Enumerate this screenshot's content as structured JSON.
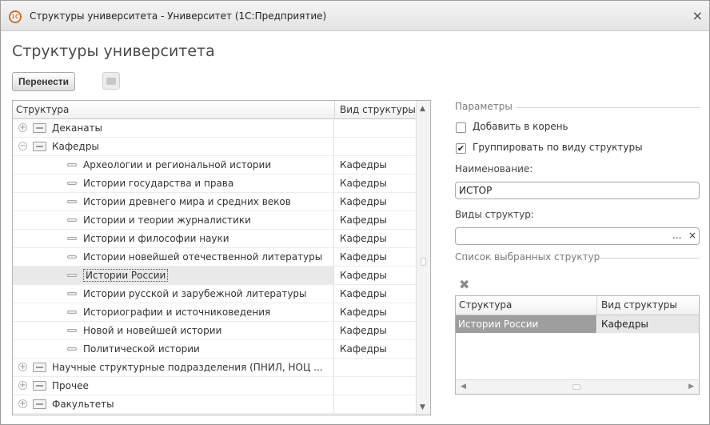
{
  "window": {
    "title": "Структуры университета - Университет  (1С:Предприятие)",
    "logo_text": "1C"
  },
  "page": {
    "title": "Структуры университета"
  },
  "toolbar": {
    "move_label": "Перенести"
  },
  "tree": {
    "columns": [
      "Структура",
      "Вид структуры"
    ],
    "rows": [
      {
        "name": "Деканаты",
        "kind": "",
        "level": 0,
        "type": "group",
        "expanded": false,
        "selected": false
      },
      {
        "name": "Кафедры",
        "kind": "",
        "level": 0,
        "type": "group",
        "expanded": true,
        "selected": false
      },
      {
        "name": "Археологии и региональной истории",
        "kind": "Кафедры",
        "level": 1,
        "type": "item",
        "selected": false
      },
      {
        "name": "Истории государства и права",
        "kind": "Кафедры",
        "level": 1,
        "type": "item",
        "selected": false
      },
      {
        "name": "Истории древнего мира и средних веков",
        "kind": "Кафедры",
        "level": 1,
        "type": "item",
        "selected": false
      },
      {
        "name": "Истории и теории журналистики",
        "kind": "Кафедры",
        "level": 1,
        "type": "item",
        "selected": false
      },
      {
        "name": "Истории и философии науки",
        "kind": "Кафедры",
        "level": 1,
        "type": "item",
        "selected": false
      },
      {
        "name": "Истории новейшей отечественной литературы",
        "kind": "Кафедры",
        "level": 1,
        "type": "item",
        "selected": false
      },
      {
        "name": "Истории России",
        "kind": "Кафедры",
        "level": 1,
        "type": "item",
        "selected": true
      },
      {
        "name": "Истории русской и зарубежной литературы",
        "kind": "Кафедры",
        "level": 1,
        "type": "item",
        "selected": false
      },
      {
        "name": "Историографии и  источниковедения",
        "kind": "Кафедры",
        "level": 1,
        "type": "item",
        "selected": false
      },
      {
        "name": "Новой и новейшей истории",
        "kind": "Кафедры",
        "level": 1,
        "type": "item",
        "selected": false
      },
      {
        "name": "Политической истории",
        "kind": "Кафедры",
        "level": 1,
        "type": "item",
        "selected": false
      },
      {
        "name": "Научные структурные подразделения (ПНИЛ, НОЦ ...",
        "kind": "",
        "level": 0,
        "type": "group",
        "expanded": false,
        "selected": false
      },
      {
        "name": "Прочее",
        "kind": "",
        "level": 0,
        "type": "group",
        "expanded": false,
        "selected": false
      },
      {
        "name": "Факультеты",
        "kind": "",
        "level": 0,
        "type": "group",
        "expanded": false,
        "selected": false
      }
    ]
  },
  "params": {
    "group_title": "Параметры",
    "add_to_root": {
      "label": "Добавить в корень",
      "checked": false
    },
    "group_by_kind": {
      "label": "Группировать по виду структуры",
      "checked": true
    },
    "name_label": "Наименование:",
    "name_value": "ИСТОР",
    "kinds_label": "Виды структур:",
    "kinds_value": "",
    "choose_button": "...",
    "clear_button": "×"
  },
  "selected_list": {
    "group_title": "Список выбранных структур",
    "columns": [
      "Структура",
      "Вид структуры"
    ],
    "rows": [
      {
        "name": "Истории России",
        "kind": "Кафедры"
      }
    ]
  }
}
